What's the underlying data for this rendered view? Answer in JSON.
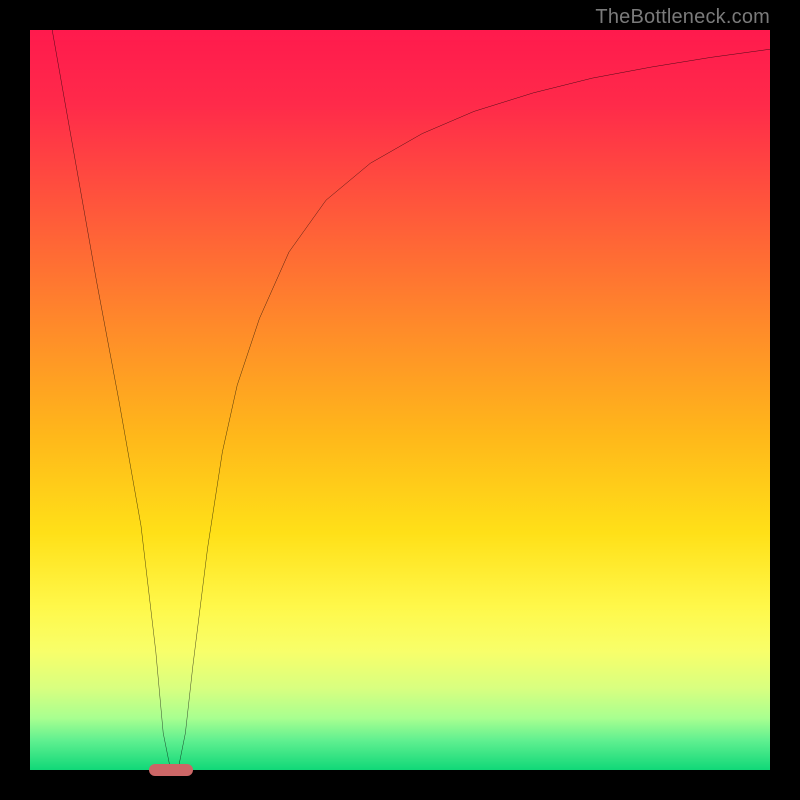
{
  "watermark": {
    "text": "TheBottleneck.com"
  },
  "colors": {
    "frame": "#000000",
    "gradient_top": "#ff1a4d",
    "gradient_bottom": "#10d878",
    "curve": "#000000",
    "marker": "#cc6666",
    "watermark_text": "#7a7a7a"
  },
  "chart_data": {
    "type": "line",
    "title": "",
    "xlabel": "",
    "ylabel": "",
    "xlim": [
      0,
      100
    ],
    "ylim": [
      0,
      100
    ],
    "grid": false,
    "legend": false,
    "series": [
      {
        "name": "curve",
        "x": [
          3,
          6,
          9,
          12,
          15,
          17,
          18,
          19,
          20,
          21,
          22,
          24,
          26,
          28,
          31,
          35,
          40,
          46,
          53,
          60,
          68,
          76,
          84,
          92,
          100
        ],
        "values": [
          100,
          83,
          66,
          50,
          33,
          16,
          5,
          0,
          0,
          5,
          14,
          30,
          43,
          52,
          61,
          70,
          77,
          82,
          86,
          89,
          91.5,
          93.5,
          95,
          96.3,
          97.4
        ],
        "note": "values are 0 at bottom (green) to 100 at top (red); curve is a V with minimum at x≈19 then asymptotic rise toward top-right"
      }
    ],
    "marker": {
      "x": 19,
      "y": 0,
      "shape": "rounded-bar"
    },
    "background": "vertical red-orange-yellow-green gradient (red top, green bottom)"
  }
}
